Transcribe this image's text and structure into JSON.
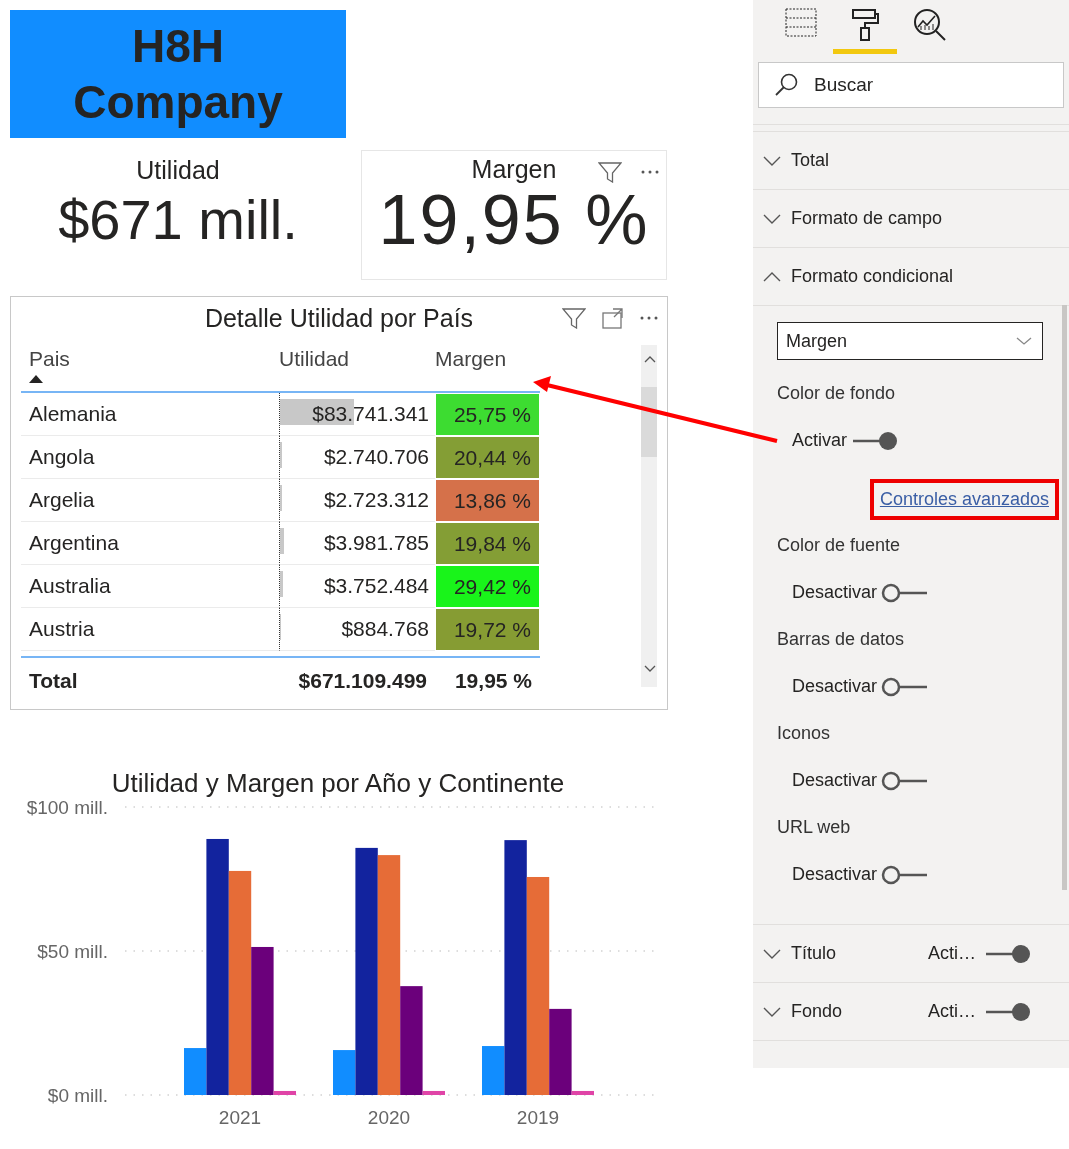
{
  "title_card": {
    "text": "H8H Company"
  },
  "kpis": [
    {
      "kind": "plain",
      "label": "Utilidad",
      "value": "$671 mill."
    },
    {
      "kind": "card",
      "label": "Margen",
      "value": "19,95 %"
    }
  ],
  "table_visual": {
    "title": "Detalle Utilidad por País",
    "columns": [
      {
        "label": "Pais",
        "sorted": true
      },
      {
        "label": "Utilidad",
        "sorted": false
      },
      {
        "label": "Margen",
        "sorted": false
      }
    ],
    "rows": [
      {
        "pais": "Alemania",
        "utilidad": "$83.741.341",
        "level": 0.48,
        "margen": "25,75 %",
        "color": "#3ddc31"
      },
      {
        "pais": "Angola",
        "utilidad": "$2.740.706",
        "level": 0.016,
        "margen": "20,44 %",
        "color": "#849e35"
      },
      {
        "pais": "Argelia",
        "utilidad": "$2.723.312",
        "level": 0.016,
        "margen": "13,86 %",
        "color": "#d5714a"
      },
      {
        "pais": "Argentina",
        "utilidad": "$3.981.785",
        "level": 0.023,
        "margen": "19,84 %",
        "color": "#849e35"
      },
      {
        "pais": "Australia",
        "utilidad": "$3.752.484",
        "level": 0.022,
        "margen": "29,42 %",
        "color": "#19f41a"
      },
      {
        "pais": "Austria",
        "utilidad": "$884.768",
        "level": 0.005,
        "margen": "19,72 %",
        "color": "#869c33"
      }
    ],
    "total": {
      "label": "Total",
      "utilidad": "$671.109.499",
      "margen": "19,95 %"
    }
  },
  "chart": {
    "title": "Utilidad y Margen por Año y Continente",
    "chart_data": {
      "type": "bar",
      "categories": [
        "2021",
        "2020",
        "2019"
      ],
      "series": [
        {
          "color": "#118dff",
          "values": [
            16.3,
            15.6,
            17
          ]
        },
        {
          "color": "#12239e",
          "values": [
            88.9,
            85.8,
            88.5
          ]
        },
        {
          "color": "#e66c37",
          "values": [
            77.8,
            83.3,
            75.7
          ]
        },
        {
          "color": "#6b007b",
          "values": [
            51.4,
            37.8,
            29.9
          ]
        },
        {
          "color": "#e044a7",
          "values": [
            1.4,
            1.4,
            1.4
          ]
        }
      ],
      "ylim": [
        0,
        100
      ],
      "yticks": [
        {
          "value": 0,
          "label": "$0 mill."
        },
        {
          "value": 50,
          "label": "$50 mill."
        },
        {
          "value": 100,
          "label": "$100 mill."
        }
      ]
    }
  },
  "format_pane": {
    "tabs": [
      {
        "kind": "fields",
        "selected": false
      },
      {
        "kind": "format",
        "selected": true
      },
      {
        "kind": "analytics",
        "selected": false
      }
    ],
    "search": {
      "placeholder": "Buscar"
    },
    "sections": [
      {
        "label": "Total",
        "expanded": false
      },
      {
        "label": "Formato de campo",
        "expanded": false
      },
      {
        "label": "Formato condicional",
        "expanded": true,
        "field": "Margen",
        "settings": [
          {
            "label": "Color de fondo",
            "state_label": "Activar",
            "on": true,
            "link": {
              "label": "Controles avanzados",
              "highlighted": true
            }
          },
          {
            "label": "Color de fuente",
            "state_label": "Desactivar",
            "on": false
          },
          {
            "label": "Barras de datos",
            "state_label": "Desactivar",
            "on": false
          },
          {
            "label": "Iconos",
            "state_label": "Desactivar",
            "on": false
          },
          {
            "label": "URL web",
            "state_label": "Desactivar",
            "on": false
          }
        ]
      },
      {
        "label": "Título",
        "expanded": false,
        "toggle": {
          "label": "Acti…",
          "on": true
        }
      },
      {
        "label": "Fondo",
        "expanded": false,
        "toggle": {
          "label": "Acti…",
          "on": true
        }
      }
    ]
  }
}
